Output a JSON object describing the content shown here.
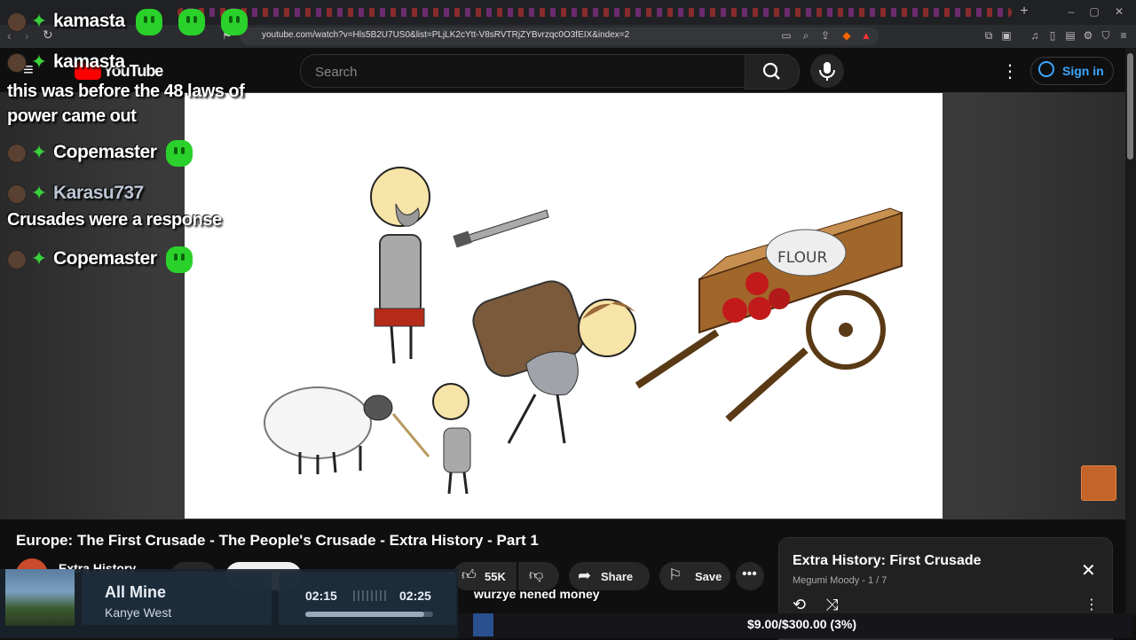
{
  "browser": {
    "url": "youtube.com/watch?v=Hls5B2U7US0&list=PLjLK2cYtt-V8sRVTRjZYBvrzqc0O3fEIX&index=2"
  },
  "youtube": {
    "logo_text": "YouTube",
    "search_placeholder": "Search",
    "sign_in_label": "Sign in"
  },
  "chat": {
    "messages": [
      {
        "user": "kamasta",
        "text": ""
      },
      {
        "user": "kamasta",
        "text": "this was before the 48 laws of power came out"
      },
      {
        "user": "Copemaster",
        "text": ""
      },
      {
        "user": "Karasu737",
        "text": "Crusades were a response"
      },
      {
        "user": "Copemaster",
        "text": ""
      }
    ]
  },
  "video": {
    "title": "Europe: The First Crusade - The People's Crusade - Extra History - Part 1",
    "channel": "Extra History",
    "likes": "55K",
    "share_label": "Share",
    "save_label": "Save",
    "illustration_text": "FLOUR"
  },
  "playlist": {
    "title": "Extra History: First Crusade",
    "subtitle": "Megumi Moody - 1 / 7"
  },
  "music": {
    "title": "All Mine",
    "artist": "Kanye West",
    "elapsed": "02:15",
    "total": "02:25",
    "progress": 0.93
  },
  "donation": {
    "message": "wurzye nened money",
    "goal_text": "$9.00/$300.00 (3%)",
    "progress": 0.03
  },
  "colors": {
    "youtube_red": "#ff0000",
    "link_blue": "#3ea6ff",
    "twitch_emote_green": "#2bd12b"
  }
}
